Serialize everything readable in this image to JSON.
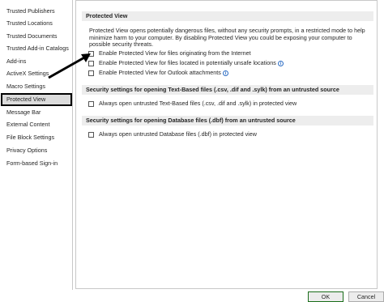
{
  "sidebar": {
    "items": [
      {
        "label": "Trusted Publishers"
      },
      {
        "label": "Trusted Locations"
      },
      {
        "label": "Trusted Documents"
      },
      {
        "label": "Trusted Add-in Catalogs"
      },
      {
        "label": "Add-ins"
      },
      {
        "label": "ActiveX Settings"
      },
      {
        "label": "Macro Settings"
      },
      {
        "label": "Protected View",
        "selected": true
      },
      {
        "label": "Message Bar"
      },
      {
        "label": "External Content"
      },
      {
        "label": "File Block Settings"
      },
      {
        "label": "Privacy Options"
      },
      {
        "label": "Form-based Sign-in"
      }
    ]
  },
  "main": {
    "protected_view": {
      "header": "Protected View",
      "description": "Protected View opens potentially dangerous files, without any security prompts, in a restricted mode to help minimize harm to your computer. By disabling Protected View you could be exposing your computer to possible security threats.",
      "options": [
        {
          "label": "Enable Protected View for files originating from the Internet",
          "checked": false
        },
        {
          "label": "Enable Protected View for files located in potentially unsafe locations",
          "checked": false,
          "info": true
        },
        {
          "label": "Enable Protected View for Outlook attachments",
          "checked": false,
          "info": true
        }
      ]
    },
    "text_files": {
      "header": "Security settings for opening Text-Based files (.csv, .dif and .sylk) from an untrusted source",
      "option": {
        "label": "Always open untrusted Text-Based files (.csv, .dif and .sylk) in protected view",
        "checked": false
      }
    },
    "database_files": {
      "header": "Security settings for opening Database files (.dbf) from an untrusted source",
      "option": {
        "label": "Always open untrusted Database files (.dbf) in protected view",
        "checked": false
      }
    }
  },
  "footer": {
    "ok_label": "OK",
    "cancel_label": "Cancel"
  },
  "info_glyph": "i",
  "colors": {
    "accent_info": "#2b6cc4",
    "ok_border": "#1a6d1a",
    "selection_outline": "#000000",
    "arrow": "#000000"
  }
}
